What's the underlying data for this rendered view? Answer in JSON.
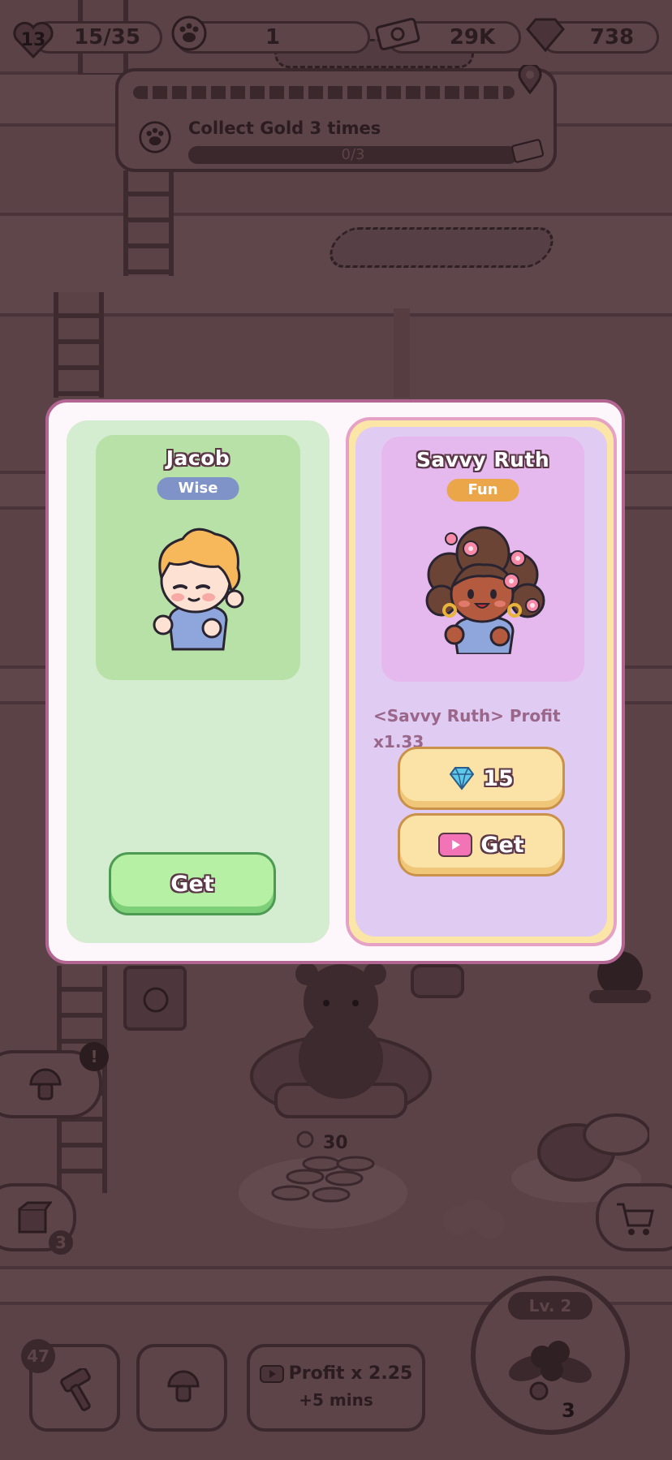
{
  "hud": {
    "level": "13",
    "progress": "15/35",
    "paw_count": "1",
    "cash": "29K",
    "gems": "738"
  },
  "quest": {
    "title": "Collect Gold 3 times",
    "progress": "0/3"
  },
  "scene": {
    "coin_pile_amount": "30",
    "alert_mark": "!",
    "box_badge": "3"
  },
  "bottom_bar": {
    "hammer_badge": "47",
    "profit_label": "Profit x 2.25",
    "profit_time": "+5 mins",
    "level_label": "Lv. 2",
    "flower_badge": "3"
  },
  "modal": {
    "left": {
      "name": "Jacob",
      "trait": "Wise",
      "trait_color": "#7f93c8",
      "get_label": "Get"
    },
    "right": {
      "name": "Savvy Ruth",
      "trait": "Fun",
      "trait_color": "#eba649",
      "perk": "<Savvy Ruth> Profit x1.33",
      "gem_cost": "15",
      "ad_get_label": "Get"
    }
  },
  "colors": {
    "modal_border": "#b36592",
    "left_panel": "#d4ecd0",
    "right_panel": "#e0cbf3",
    "dim_overlay": "#5a4247"
  }
}
